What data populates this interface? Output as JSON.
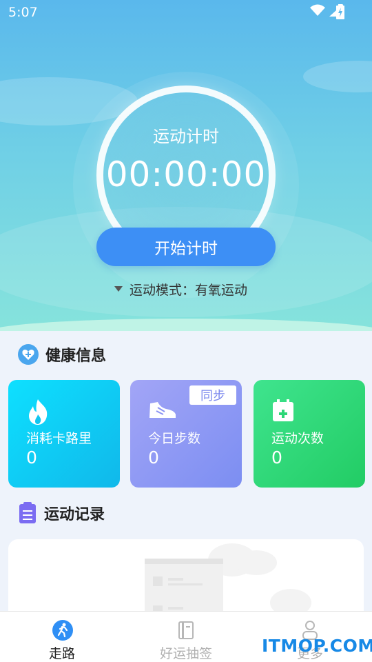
{
  "status_bar": {
    "time": "5:07"
  },
  "timer": {
    "title": "运动计时",
    "value": "00:00:00",
    "start_label": "开始计时"
  },
  "mode": {
    "text": "运动模式：有氧运动"
  },
  "health": {
    "title": "健康信息",
    "cards": [
      {
        "label": "消耗卡路里",
        "value": "0",
        "icon": "flame-icon",
        "color": "#10c6f0"
      },
      {
        "label": "今日步数",
        "value": "0",
        "icon": "sneaker-icon",
        "color": "#8a92f4",
        "badge": "同步"
      },
      {
        "label": "运动次数",
        "value": "0",
        "icon": "calendar-plus-icon",
        "color": "#2dd777"
      }
    ]
  },
  "records": {
    "title": "运动记录"
  },
  "tabs": [
    {
      "label": "走路",
      "icon": "walk-icon",
      "active": true
    },
    {
      "label": "好运抽签",
      "icon": "notebook-icon",
      "active": false
    },
    {
      "label": "更多",
      "icon": "person-icon",
      "active": false
    }
  ],
  "watermark": "ITMOP.COM"
}
